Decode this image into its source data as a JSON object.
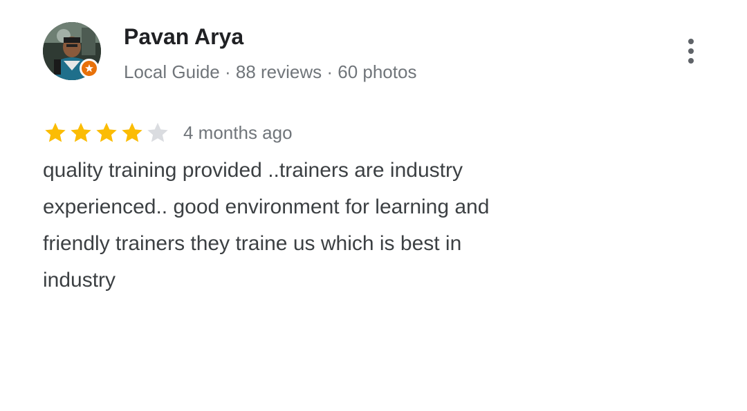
{
  "reviewer": {
    "name": "Pavan Arya",
    "meta": "Local Guide · 88 reviews · 60 photos",
    "avatar_icon": "profile-photo",
    "badge_icon": "local-guide-badge-icon"
  },
  "menu": {
    "icon": "more-vert-icon"
  },
  "review": {
    "rating": 4,
    "rating_max": 5,
    "date": "4 months ago",
    "text": "quality training provided  ..trainers are industry\nexperienced..  good environment for learning and\nfriendly trainers  they traine us which is best in\nindustry"
  },
  "colors": {
    "star_filled": "#FBBC04",
    "star_empty": "#DADCE0",
    "badge": "#E8710A",
    "secondary_text": "#70757A"
  }
}
